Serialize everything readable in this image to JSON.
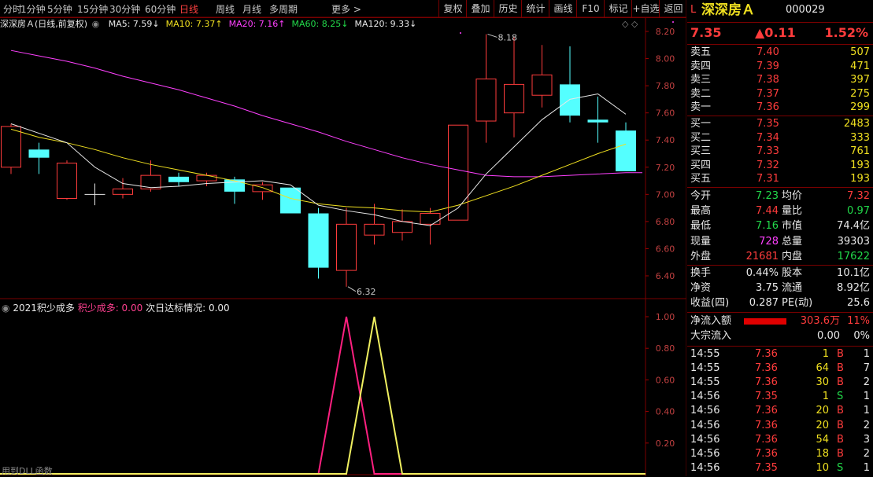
{
  "toolbar": {
    "periods": [
      "分时",
      "1分钟",
      "5分钟",
      "15分钟",
      "30分钟",
      "60分钟",
      "日线",
      "周线",
      "月线",
      "多周期",
      "更多 >"
    ],
    "active_index": 6,
    "buttons": [
      "复权",
      "叠加",
      "历史",
      "统计",
      "画线",
      "F10",
      "标记",
      "+自选",
      "返回"
    ]
  },
  "header": {
    "stock_label": "深深房Ａ(日线,前复权)",
    "ma": [
      {
        "text": "MA5: 7.59↓",
        "color": "#e8e8e8"
      },
      {
        "text": "MA10: 7.37↑",
        "color": "#f0e020"
      },
      {
        "text": "MA20: 7.16↑",
        "color": "#ff40ff"
      },
      {
        "text": "MA60: 8.25↓",
        "color": "#22d94a"
      },
      {
        "text": "MA120: 9.33↓",
        "color": "#e8e8e8"
      }
    ]
  },
  "indicator_header": {
    "name": "2021积少成多",
    "param_label": "积少成多: 0.00",
    "param2_label": "次日达标情况: 0.00"
  },
  "price_axis": [
    "8.20",
    "8.00",
    "7.80",
    "7.60",
    "7.40",
    "7.20",
    "7.00",
    "6.80",
    "6.60",
    "6.40"
  ],
  "indicator_axis": [
    "1.00",
    "0.80",
    "0.60",
    "0.40",
    "0.20"
  ],
  "annotations": {
    "high": "8.18",
    "low": "6.32"
  },
  "chart_data": {
    "type": "candlestick",
    "ylim": [
      6.3,
      8.22
    ],
    "candles": [
      {
        "o": 7.2,
        "c": 7.5,
        "h": 7.52,
        "l": 7.15
      },
      {
        "o": 7.33,
        "c": 7.27,
        "h": 7.38,
        "l": 7.15
      },
      {
        "o": 6.97,
        "c": 7.23,
        "h": 7.25,
        "l": 6.96
      },
      {
        "o": 7.0,
        "c": 7.0,
        "h": 7.08,
        "l": 6.92
      },
      {
        "o": 7.0,
        "c": 7.04,
        "h": 7.12,
        "l": 6.97
      },
      {
        "o": 7.04,
        "c": 7.14,
        "h": 7.25,
        "l": 7.02
      },
      {
        "o": 7.13,
        "c": 7.09,
        "h": 7.16,
        "l": 7.06
      },
      {
        "o": 7.1,
        "c": 7.14,
        "h": 7.16,
        "l": 7.06
      },
      {
        "o": 7.11,
        "c": 7.02,
        "h": 7.13,
        "l": 6.93
      },
      {
        "o": 7.02,
        "c": 7.07,
        "h": 7.09,
        "l": 6.96
      },
      {
        "o": 7.05,
        "c": 6.86,
        "h": 7.05,
        "l": 6.86
      },
      {
        "o": 6.86,
        "c": 6.46,
        "h": 6.9,
        "l": 6.38
      },
      {
        "o": 6.44,
        "c": 6.78,
        "h": 6.9,
        "l": 6.32
      },
      {
        "o": 6.7,
        "c": 6.78,
        "h": 6.93,
        "l": 6.63
      },
      {
        "o": 6.72,
        "c": 6.8,
        "h": 6.89,
        "l": 6.66
      },
      {
        "o": 6.78,
        "c": 6.86,
        "h": 6.9,
        "l": 6.63
      },
      {
        "o": 6.81,
        "c": 7.51,
        "h": 7.51,
        "l": 6.81
      },
      {
        "o": 7.54,
        "c": 7.85,
        "h": 8.18,
        "l": 7.38
      },
      {
        "o": 7.6,
        "c": 7.81,
        "h": 8.16,
        "l": 7.42
      },
      {
        "o": 7.73,
        "c": 7.88,
        "h": 8.1,
        "l": 7.64
      },
      {
        "o": 7.81,
        "c": 7.58,
        "h": 8.09,
        "l": 7.53
      },
      {
        "o": 7.55,
        "c": 7.53,
        "h": 7.72,
        "l": 7.38
      },
      {
        "o": 7.47,
        "c": 7.17,
        "h": 7.53,
        "l": 7.17
      }
    ],
    "ma5": [
      7.52,
      7.45,
      7.38,
      7.2,
      7.08,
      7.05,
      7.06,
      7.08,
      7.09,
      7.1,
      7.07,
      6.92,
      6.88,
      6.85,
      6.8,
      6.77,
      6.9,
      7.15,
      7.35,
      7.55,
      7.7,
      7.74,
      7.59
    ],
    "ma10": [
      7.48,
      7.42,
      7.38,
      7.33,
      7.27,
      7.22,
      7.18,
      7.14,
      7.1,
      7.05,
      6.97,
      6.93,
      6.91,
      6.9,
      6.88,
      6.87,
      6.92,
      6.99,
      7.06,
      7.14,
      7.22,
      7.3,
      7.37
    ],
    "ma20": [
      8.06,
      8.02,
      7.98,
      7.93,
      7.87,
      7.82,
      7.77,
      7.71,
      7.65,
      7.58,
      7.52,
      7.46,
      7.39,
      7.33,
      7.27,
      7.22,
      7.18,
      7.14,
      7.13,
      7.13,
      7.14,
      7.15,
      7.16
    ],
    "indicator": {
      "ylim": [
        0,
        1.04
      ],
      "series1_peak_index": 12,
      "series2_peak_index": 13
    }
  },
  "quote": {
    "flag": "L",
    "name": "深深房Ａ",
    "code": "000029",
    "price": "7.35",
    "change": "▲0.11",
    "pct": "1.52%",
    "sell": [
      {
        "label": "卖五",
        "price": "7.40",
        "vol": "507"
      },
      {
        "label": "卖四",
        "price": "7.39",
        "vol": "471"
      },
      {
        "label": "卖三",
        "price": "7.38",
        "vol": "397"
      },
      {
        "label": "卖二",
        "price": "7.37",
        "vol": "275"
      },
      {
        "label": "卖一",
        "price": "7.36",
        "vol": "299"
      }
    ],
    "buy": [
      {
        "label": "买一",
        "price": "7.35",
        "vol": "2483"
      },
      {
        "label": "买二",
        "price": "7.34",
        "vol": "333"
      },
      {
        "label": "买三",
        "price": "7.33",
        "vol": "761"
      },
      {
        "label": "买四",
        "price": "7.32",
        "vol": "193"
      },
      {
        "label": "买五",
        "price": "7.31",
        "vol": "193"
      }
    ],
    "stats": [
      {
        "l1": "今开",
        "v1": "7.23",
        "c1": "#22d94a",
        "l2": "均价",
        "v2": "7.32",
        "c2": "#ff3c3c"
      },
      {
        "l1": "最高",
        "v1": "7.44",
        "c1": "#ff3c3c",
        "l2": "量比",
        "v2": "0.97",
        "c2": "#22d94a"
      },
      {
        "l1": "最低",
        "v1": "7.16",
        "c1": "#22d94a",
        "l2": "市值",
        "v2": "74.4亿",
        "c2": "#e8e8e8"
      },
      {
        "l1": "现量",
        "v1": "728",
        "c1": "#ff40ff",
        "l2": "总量",
        "v2": "39303",
        "c2": "#e8e8e8"
      },
      {
        "l1": "外盘",
        "v1": "21681",
        "c1": "#ff3c3c",
        "l2": "内盘",
        "v2": "17622",
        "c2": "#22d94a"
      }
    ],
    "stats2": [
      {
        "l1": "换手",
        "v1": "0.44%",
        "l2": "股本",
        "v2": "10.1亿"
      },
      {
        "l1": "净资",
        "v1": "3.75",
        "l2": "流通",
        "v2": "8.92亿"
      },
      {
        "l1": "收益(四)",
        "v1": "0.287",
        "l2": "PE(动)",
        "v2": "25.6"
      }
    ],
    "flow": [
      {
        "label": "净流入额",
        "value": "303.6万",
        "pct": "11%"
      },
      {
        "label": "大宗流入",
        "value": "0.00",
        "pct": "0%"
      }
    ],
    "ticks": [
      {
        "t": "14:55",
        "p": "7.36",
        "v": "1",
        "bs": "B",
        "n": "1"
      },
      {
        "t": "14:55",
        "p": "7.36",
        "v": "64",
        "bs": "B",
        "n": "7"
      },
      {
        "t": "14:55",
        "p": "7.36",
        "v": "30",
        "bs": "B",
        "n": "2"
      },
      {
        "t": "14:56",
        "p": "7.35",
        "v": "1",
        "bs": "S",
        "n": "1"
      },
      {
        "t": "14:56",
        "p": "7.36",
        "v": "20",
        "bs": "B",
        "n": "1"
      },
      {
        "t": "14:56",
        "p": "7.36",
        "v": "20",
        "bs": "B",
        "n": "2"
      },
      {
        "t": "14:56",
        "p": "7.36",
        "v": "54",
        "bs": "B",
        "n": "3"
      },
      {
        "t": "14:56",
        "p": "7.36",
        "v": "18",
        "bs": "B",
        "n": "2"
      },
      {
        "t": "14:56",
        "p": "7.35",
        "v": "10",
        "bs": "S",
        "n": "1"
      }
    ]
  },
  "footer_note": "用到DLL函数"
}
